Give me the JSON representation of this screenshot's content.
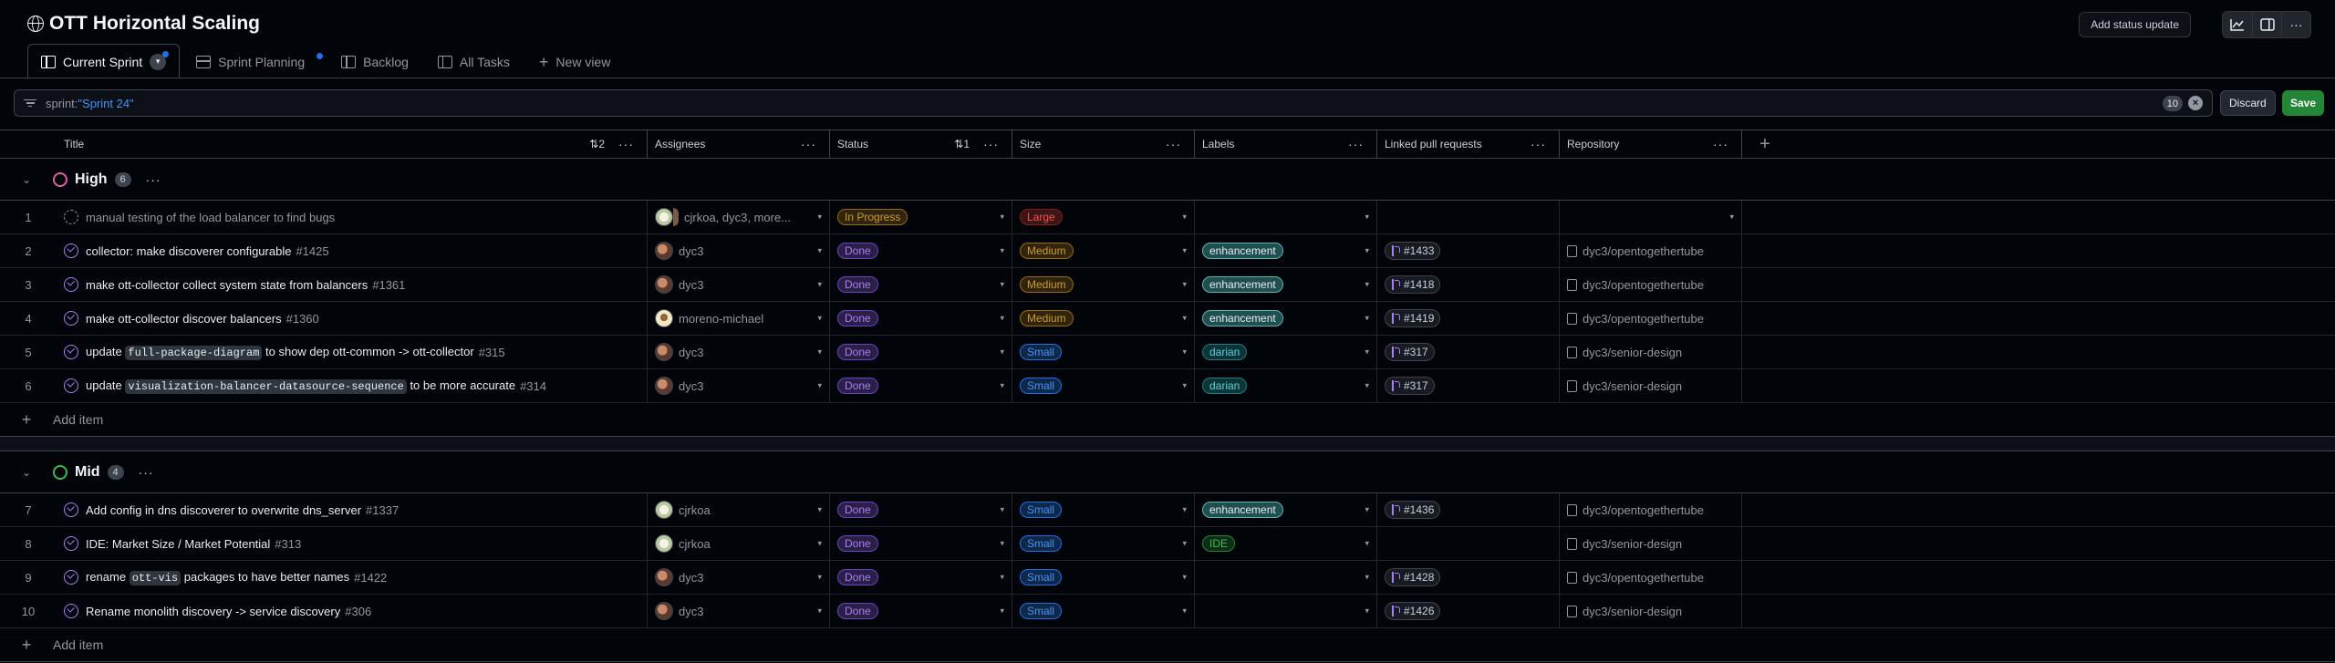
{
  "project": {
    "title": "OTT Horizontal Scaling"
  },
  "toolbar": {
    "status_update_label": "Add status update",
    "more_icon": "···"
  },
  "tabs": [
    {
      "label": "Current Sprint",
      "icon": "table-icon",
      "active": true
    },
    {
      "label": "Sprint Planning",
      "icon": "board-icon",
      "active": false
    },
    {
      "label": "Backlog",
      "icon": "table-icon",
      "active": false
    },
    {
      "label": "All Tasks",
      "icon": "table-icon",
      "active": false
    },
    {
      "label": "New view",
      "icon": "plus-icon",
      "active": false
    }
  ],
  "filter": {
    "key": "sprint:",
    "value": "\"Sprint 24\"",
    "count": "10",
    "discard_label": "Discard",
    "save_label": "Save"
  },
  "columns": {
    "title": "Title",
    "title_sort": "2",
    "assignees": "Assignees",
    "status": "Status",
    "status_sort": "1",
    "size": "Size",
    "labels": "Labels",
    "linked_prs": "Linked pull requests",
    "repository": "Repository"
  },
  "groups": [
    {
      "name": "High",
      "count": "6",
      "color": "#db61a2",
      "rows": [
        {
          "num": "1",
          "draft": true,
          "title_parts": [
            {
              "t": "manual testing of the load balancer to find bugs"
            }
          ],
          "issue_num": "",
          "assignee": "cjrkoa, dyc3, more...",
          "avatar": "cjrkoa",
          "stack": true,
          "status": "In Progress",
          "size": "Large",
          "label": "",
          "pr": "",
          "repo": ""
        },
        {
          "num": "2",
          "draft": false,
          "title_parts": [
            {
              "t": "collector: make discoverer configurable"
            }
          ],
          "issue_num": "#1425",
          "assignee": "dyc3",
          "avatar": "dyc3",
          "stack": false,
          "status": "Done",
          "size": "Medium",
          "label": "enhancement",
          "pr": "#1433",
          "repo": "dyc3/opentogethertube"
        },
        {
          "num": "3",
          "draft": false,
          "title_parts": [
            {
              "t": "make ott-collector collect system state from balancers"
            }
          ],
          "issue_num": "#1361",
          "assignee": "dyc3",
          "avatar": "dyc3",
          "stack": false,
          "status": "Done",
          "size": "Medium",
          "label": "enhancement",
          "pr": "#1418",
          "repo": "dyc3/opentogethertube"
        },
        {
          "num": "4",
          "draft": false,
          "title_parts": [
            {
              "t": "make ott-collector discover balancers"
            }
          ],
          "issue_num": "#1360",
          "assignee": "moreno-michael",
          "avatar": "moreno",
          "stack": false,
          "status": "Done",
          "size": "Medium",
          "label": "enhancement",
          "pr": "#1419",
          "repo": "dyc3/opentogethertube"
        },
        {
          "num": "5",
          "draft": false,
          "title_parts": [
            {
              "t": "update "
            },
            {
              "c": "full-package-diagram"
            },
            {
              "t": " to show dep ott-common -> ott-collector"
            }
          ],
          "issue_num": "#315",
          "assignee": "dyc3",
          "avatar": "dyc3",
          "stack": false,
          "status": "Done",
          "size": "Small",
          "label": "darian",
          "pr": "#317",
          "repo": "dyc3/senior-design"
        },
        {
          "num": "6",
          "draft": false,
          "title_parts": [
            {
              "t": "update "
            },
            {
              "c": "visualization-balancer-datasource-sequence"
            },
            {
              "t": " to be more accurate"
            }
          ],
          "issue_num": "#314",
          "assignee": "dyc3",
          "avatar": "dyc3",
          "stack": false,
          "status": "Done",
          "size": "Small",
          "label": "darian",
          "pr": "#317",
          "repo": "dyc3/senior-design"
        }
      ]
    },
    {
      "name": "Mid",
      "count": "4",
      "color": "#3fb950",
      "rows": [
        {
          "num": "7",
          "draft": false,
          "title_parts": [
            {
              "t": "Add config in dns discoverer to overwrite dns_server"
            }
          ],
          "issue_num": "#1337",
          "assignee": "cjrkoa",
          "avatar": "cjrkoa",
          "stack": false,
          "status": "Done",
          "size": "Small",
          "label": "enhancement",
          "pr": "#1436",
          "repo": "dyc3/opentogethertube"
        },
        {
          "num": "8",
          "draft": false,
          "title_parts": [
            {
              "t": "IDE: Market Size / Market Potential"
            }
          ],
          "issue_num": "#313",
          "assignee": "cjrkoa",
          "avatar": "cjrkoa",
          "stack": false,
          "status": "Done",
          "size": "Small",
          "label": "IDE",
          "pr": "",
          "repo": "dyc3/senior-design"
        },
        {
          "num": "9",
          "draft": false,
          "title_parts": [
            {
              "t": "rename "
            },
            {
              "c": "ott-vis"
            },
            {
              "t": " packages to have better names"
            }
          ],
          "issue_num": "#1422",
          "assignee": "dyc3",
          "avatar": "dyc3",
          "stack": false,
          "status": "Done",
          "size": "Small",
          "label": "",
          "pr": "#1428",
          "repo": "dyc3/opentogethertube"
        },
        {
          "num": "10",
          "draft": false,
          "title_parts": [
            {
              "t": "Rename monolith discovery -> service discovery"
            }
          ],
          "issue_num": "#306",
          "assignee": "dyc3",
          "avatar": "dyc3",
          "stack": false,
          "status": "Done",
          "size": "Small",
          "label": "",
          "pr": "#1426",
          "repo": "dyc3/senior-design"
        }
      ]
    }
  ],
  "add_item_label": "Add item",
  "pill_colors": {
    "In Progress": {
      "fg": "#d29922",
      "bg": "#2e2410",
      "bd": "#9e6a03"
    },
    "Done": {
      "fg": "#ab7df8",
      "bg": "#2a1f45",
      "bd": "#6e40c9"
    },
    "Large": {
      "fg": "#f85149",
      "bg": "#3a1616",
      "bd": "#8e1519"
    },
    "Medium": {
      "fg": "#d29922",
      "bg": "#2e2410",
      "bd": "#9e6a03"
    },
    "Small": {
      "fg": "#4493f8",
      "bg": "#0f2847",
      "bd": "#1f6feb"
    },
    "enhancement": {
      "fg": "#e6edf3",
      "bg": "#1f4f4f",
      "bd": "#5fb3b3"
    },
    "darian": {
      "fg": "#56d4dd",
      "bg": "#0e3438",
      "bd": "#1b7c83"
    },
    "IDE": {
      "fg": "#3fb950",
      "bg": "#0f2e17",
      "bd": "#238636"
    }
  }
}
